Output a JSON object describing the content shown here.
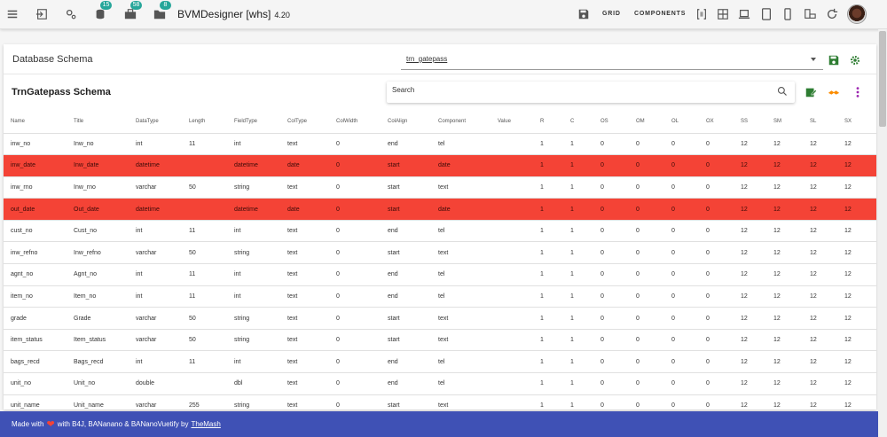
{
  "appbar": {
    "title": "BVMDesigner [whs]",
    "version": "4.20",
    "badges": {
      "database": "15",
      "briefcase": "58",
      "folder": "8"
    },
    "buttons": {
      "grid": "GRID",
      "components": "COMPONENTS"
    }
  },
  "header": {
    "title": "Database Schema",
    "selected_db": "trn_gatepass"
  },
  "schema": {
    "title": "TrnGatepass Schema",
    "search_placeholder": "Search"
  },
  "table": {
    "columns": [
      "Name",
      "Title",
      "DataType",
      "Length",
      "FieldType",
      "ColType",
      "ColWidth",
      "ColAlign",
      "Component",
      "Value",
      "R",
      "C",
      "OS",
      "OM",
      "OL",
      "OX",
      "SS",
      "SM",
      "SL",
      "SX"
    ],
    "rows": [
      [
        "inw_no",
        "Inw_no",
        "int",
        "11",
        "int",
        "text",
        "0",
        "end",
        "tel",
        "",
        "1",
        "1",
        "0",
        "0",
        "0",
        "0",
        "12",
        "12",
        "12",
        "12"
      ],
      [
        "inw_date",
        "Inw_date",
        "datetime",
        "",
        "datetime",
        "date",
        "0",
        "start",
        "date",
        "",
        "1",
        "1",
        "0",
        "0",
        "0",
        "0",
        "12",
        "12",
        "12",
        "12"
      ],
      [
        "inw_rno",
        "Inw_rno",
        "varchar",
        "50",
        "string",
        "text",
        "0",
        "start",
        "text",
        "",
        "1",
        "1",
        "0",
        "0",
        "0",
        "0",
        "12",
        "12",
        "12",
        "12"
      ],
      [
        "out_date",
        "Out_date",
        "datetime",
        "",
        "datetime",
        "date",
        "0",
        "start",
        "date",
        "",
        "1",
        "1",
        "0",
        "0",
        "0",
        "0",
        "12",
        "12",
        "12",
        "12"
      ],
      [
        "cust_no",
        "Cust_no",
        "int",
        "11",
        "int",
        "text",
        "0",
        "end",
        "tel",
        "",
        "1",
        "1",
        "0",
        "0",
        "0",
        "0",
        "12",
        "12",
        "12",
        "12"
      ],
      [
        "inw_refno",
        "Inw_refno",
        "varchar",
        "50",
        "string",
        "text",
        "0",
        "start",
        "text",
        "",
        "1",
        "1",
        "0",
        "0",
        "0",
        "0",
        "12",
        "12",
        "12",
        "12"
      ],
      [
        "agnt_no",
        "Agnt_no",
        "int",
        "11",
        "int",
        "text",
        "0",
        "end",
        "tel",
        "",
        "1",
        "1",
        "0",
        "0",
        "0",
        "0",
        "12",
        "12",
        "12",
        "12"
      ],
      [
        "item_no",
        "Item_no",
        "int",
        "11",
        "int",
        "text",
        "0",
        "end",
        "tel",
        "",
        "1",
        "1",
        "0",
        "0",
        "0",
        "0",
        "12",
        "12",
        "12",
        "12"
      ],
      [
        "grade",
        "Grade",
        "varchar",
        "50",
        "string",
        "text",
        "0",
        "start",
        "text",
        "",
        "1",
        "1",
        "0",
        "0",
        "0",
        "0",
        "12",
        "12",
        "12",
        "12"
      ],
      [
        "item_status",
        "Item_status",
        "varchar",
        "50",
        "string",
        "text",
        "0",
        "start",
        "text",
        "",
        "1",
        "1",
        "0",
        "0",
        "0",
        "0",
        "12",
        "12",
        "12",
        "12"
      ],
      [
        "bags_recd",
        "Bags_recd",
        "int",
        "11",
        "int",
        "text",
        "0",
        "end",
        "tel",
        "",
        "1",
        "1",
        "0",
        "0",
        "0",
        "0",
        "12",
        "12",
        "12",
        "12"
      ],
      [
        "unit_no",
        "Unit_no",
        "double",
        "",
        "dbl",
        "text",
        "0",
        "end",
        "tel",
        "",
        "1",
        "1",
        "0",
        "0",
        "0",
        "0",
        "12",
        "12",
        "12",
        "12"
      ],
      [
        "unit_name",
        "Unit_name",
        "varchar",
        "255",
        "string",
        "text",
        "0",
        "start",
        "text",
        "",
        "1",
        "1",
        "0",
        "0",
        "0",
        "0",
        "12",
        "12",
        "12",
        "12"
      ]
    ],
    "highlighted_rows": [
      1,
      3
    ],
    "highlight_color": "#f44336"
  },
  "footer": {
    "made_with": "Made with",
    "with_text": "with B4J, BANanano & BANanoVuetify by",
    "author_link": "TheMash"
  },
  "colors": {
    "footer": "#3f51b5",
    "badge": "#26a69a",
    "save_green": "#2e7d32",
    "purple": "#9c27b0",
    "orange": "#fb8c00"
  }
}
